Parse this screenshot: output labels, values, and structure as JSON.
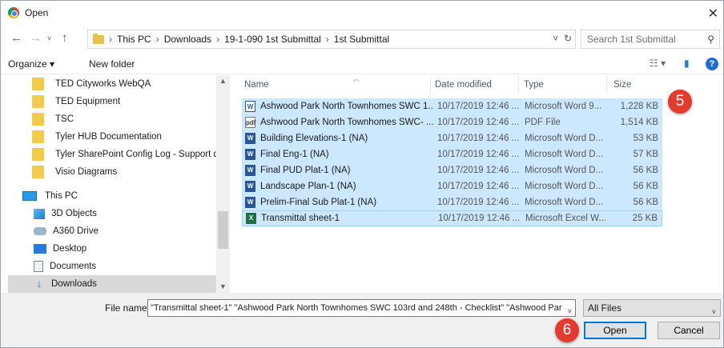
{
  "window": {
    "title": "Open"
  },
  "address": {
    "crumbs": [
      "This PC",
      "Downloads",
      "19-1-090 1st Submittal",
      "1st Submittal"
    ],
    "search_placeholder": "Search 1st Submittal"
  },
  "toolbar": {
    "organize_label": "Organize ▾",
    "new_folder_label": "New folder"
  },
  "nav": {
    "folders": [
      "TED Cityworks WebQA",
      "TED Equipment",
      "TSC",
      "Tyler HUB Documentation",
      "Tyler SharePoint Config Log - Support docu",
      "Visio Diagrams"
    ],
    "this_pc": "This PC",
    "pc_items": [
      {
        "label": "3D Objects",
        "icon": "cube-icon"
      },
      {
        "label": "A360 Drive",
        "icon": "drive-icon"
      },
      {
        "label": "Desktop",
        "icon": "desktop-icon"
      },
      {
        "label": "Documents",
        "icon": "documents-icon"
      },
      {
        "label": "Downloads",
        "icon": "download-icon"
      }
    ]
  },
  "columns": {
    "name": "Name",
    "date": "Date modified",
    "type": "Type",
    "size": "Size"
  },
  "files": [
    {
      "name": "Ashwood Park North Townhomes SWC 1...",
      "date": "10/17/2019 12:46 ...",
      "type": "Microsoft Word 9...",
      "size": "1,228 KB",
      "icon": "W"
    },
    {
      "name": "Ashwood Park North Townhomes SWC- ...",
      "date": "10/17/2019 12:46 ...",
      "type": "PDF File",
      "size": "1,514 KB",
      "icon": "pdf"
    },
    {
      "name": "Building Elevations-1 (NA)",
      "date": "10/17/2019 12:46 ...",
      "type": "Microsoft Word D...",
      "size": "53 KB",
      "icon": "W"
    },
    {
      "name": "Final Eng-1 (NA)",
      "date": "10/17/2019 12:46 ...",
      "type": "Microsoft Word D...",
      "size": "57 KB",
      "icon": "W"
    },
    {
      "name": "Final PUD Plat-1 (NA)",
      "date": "10/17/2019 12:46 ...",
      "type": "Microsoft Word D...",
      "size": "56 KB",
      "icon": "W"
    },
    {
      "name": "Landscape Plan-1 (NA)",
      "date": "10/17/2019 12:46 ...",
      "type": "Microsoft Word D...",
      "size": "56 KB",
      "icon": "W"
    },
    {
      "name": "Prelim-Final Sub Plat-1 (NA)",
      "date": "10/17/2019 12:46 ...",
      "type": "Microsoft Word D...",
      "size": "56 KB",
      "icon": "W"
    },
    {
      "name": "Transmittal sheet-1",
      "date": "10/17/2019 12:46 ...",
      "type": "Microsoft Excel W...",
      "size": "25 KB",
      "icon": "X"
    }
  ],
  "callouts": {
    "five": "5",
    "six": "6"
  },
  "bottom": {
    "file_name_label": "File name:",
    "file_name_value": "\"Transmittal sheet-1\" \"Ashwood Park North Townhomes SWC 103rd and 248th - Checklist\" \"Ashwood Par",
    "file_type_value": "All Files",
    "open_label": "Open",
    "cancel_label": "Cancel"
  },
  "colors": {
    "selection": "#cce8ff",
    "accent": "#0078d7",
    "callout": "#e53a2e"
  }
}
